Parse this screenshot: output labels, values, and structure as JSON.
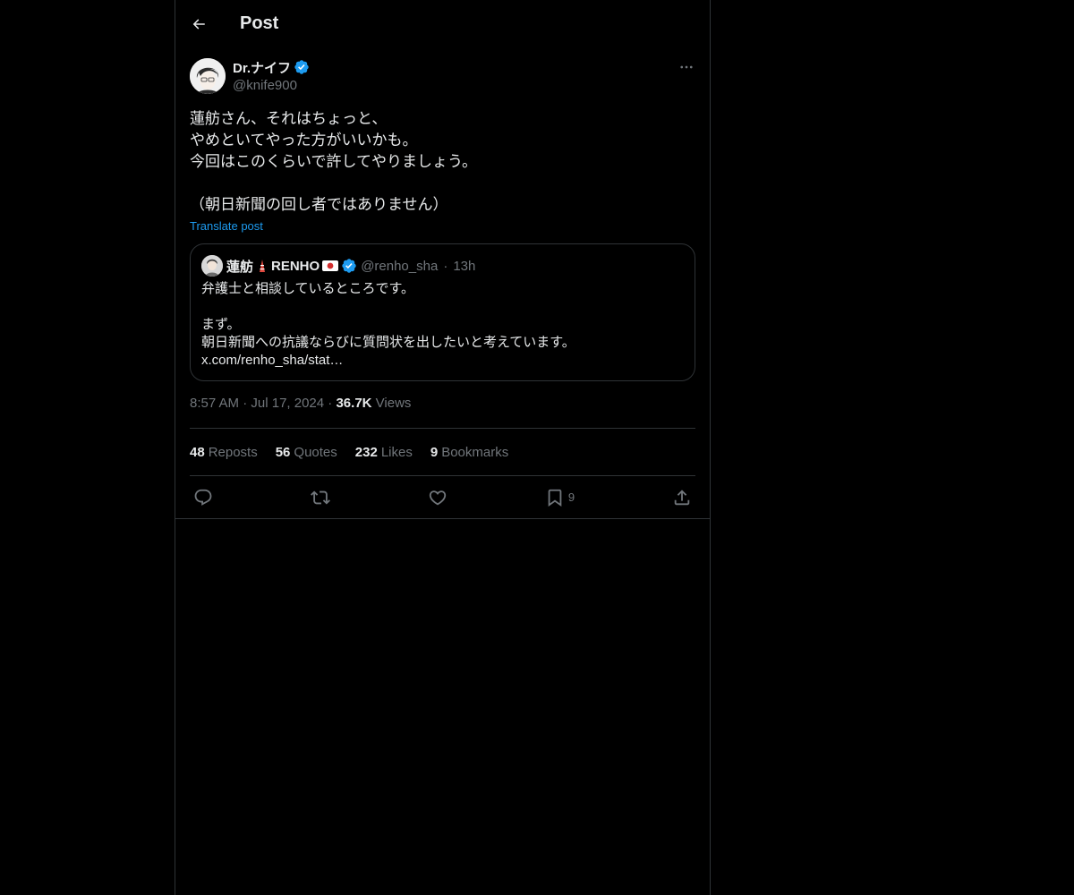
{
  "header": {
    "title": "Post"
  },
  "post": {
    "display_name": "Dr.ナイフ",
    "handle": "@knife900",
    "text": "蓮舫さん、それはちょっと、\nやめといてやった方がいいかも。\n今回はこのくらいで許してやりましょう。\n\n（朝日新聞の回し者ではありません）",
    "translate_label": "Translate post",
    "time": "8:57 AM",
    "date": "Jul 17, 2024",
    "views_count": "36.7K",
    "views_label": "Views"
  },
  "quote": {
    "display_name": "蓮舫",
    "display_name_suffix": "RENHO",
    "handle": "@renho_sha",
    "time": "13h",
    "text": "弁護士と相談しているところです。\n\nまず。\n朝日新聞への抗議ならびに質問状を出したいと考えています。\nx.com/renho_sha/stat…"
  },
  "stats": {
    "reposts_n": "48",
    "reposts_label": "Reposts",
    "quotes_n": "56",
    "quotes_label": "Quotes",
    "likes_n": "232",
    "likes_label": "Likes",
    "bookmarks_n": "9",
    "bookmarks_label": "Bookmarks"
  },
  "actions": {
    "bookmark_count": "9"
  },
  "colors": {
    "background": "#000000",
    "text": "#e7e9ea",
    "muted": "#71767b",
    "accent": "#1d9bf0",
    "border": "#2f3336"
  },
  "icons": [
    "back-arrow-icon",
    "verified-badge-icon",
    "more-icon",
    "reply-icon",
    "repost-icon",
    "like-icon",
    "bookmark-icon",
    "share-icon",
    "tokyo-tower-emoji-icon",
    "japan-flag-emoji-icon"
  ]
}
